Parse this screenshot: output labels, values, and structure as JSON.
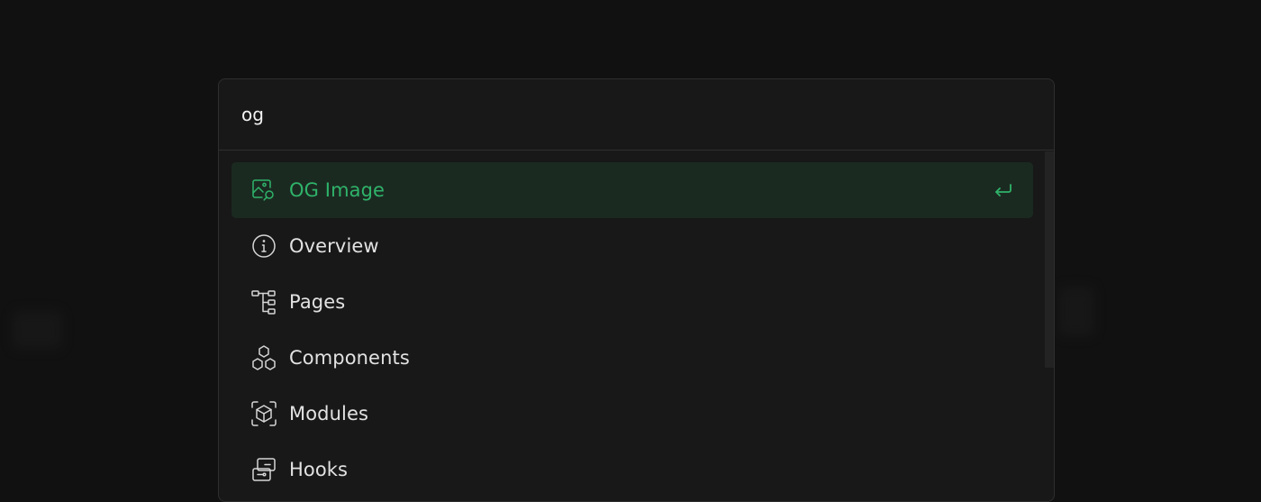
{
  "search": {
    "value": "og",
    "placeholder": ""
  },
  "results": [
    {
      "label": "OG Image",
      "icon": "image-search-icon",
      "active": true
    },
    {
      "label": "Overview",
      "icon": "info-icon",
      "active": false
    },
    {
      "label": "Pages",
      "icon": "sitemap-icon",
      "active": false
    },
    {
      "label": "Components",
      "icon": "components-icon",
      "active": false
    },
    {
      "label": "Modules",
      "icon": "cube-scan-icon",
      "active": false
    },
    {
      "label": "Hooks",
      "icon": "hooks-icon",
      "active": false
    }
  ],
  "colors": {
    "accent": "#2fb36a",
    "active_bg": "#1b2a21",
    "panel_bg": "#181818",
    "page_bg": "#111111",
    "text": "#e2e2e2"
  }
}
